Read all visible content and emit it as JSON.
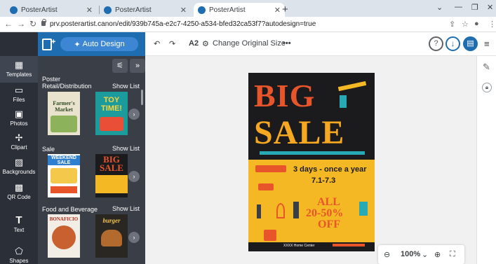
{
  "browser": {
    "tabs": [
      {
        "title": "PosterArtist",
        "active": false
      },
      {
        "title": "PosterArtist",
        "active": false
      },
      {
        "title": "PosterArtist",
        "active": true
      }
    ],
    "url": "prv.posterartist.canon/edit/939b745a-e2c7-4250-a534-bfed32ca53f7?autodesign=true"
  },
  "rail": {
    "items": [
      {
        "label": "Templates",
        "icon": "templates-icon"
      },
      {
        "label": "Files",
        "icon": "folder-icon"
      },
      {
        "label": "Photos",
        "icon": "photo-icon"
      },
      {
        "label": "Clipart",
        "icon": "clipart-icon"
      },
      {
        "label": "Backgrounds",
        "icon": "backgrounds-icon"
      },
      {
        "label": "QR Code",
        "icon": "qr-code-icon"
      },
      {
        "label": "Text",
        "icon": "text-icon"
      },
      {
        "label": "Shapes",
        "icon": "shapes-icon"
      }
    ]
  },
  "header": {
    "auto_design_label": "Auto Design"
  },
  "panel": {
    "categories": [
      {
        "title_line1": "Poster",
        "title_line2": "Retail/Distribution",
        "show_list": "Show List",
        "thumbs": [
          {
            "text": "Farmer's Market"
          },
          {
            "text": "TOY TIME!"
          }
        ]
      },
      {
        "title_line1": "Sale",
        "title_line2": "",
        "show_list": "Show List",
        "thumbs": [
          {
            "text": "WEEKEND SALE"
          },
          {
            "text": "BIG SALE"
          }
        ]
      },
      {
        "title_line1": "Food and Beverage",
        "title_line2": "",
        "show_list": "Show List",
        "thumbs": [
          {
            "text": "BONAFICIO"
          },
          {
            "text": "burger"
          }
        ]
      }
    ]
  },
  "editor_toolbar": {
    "size": "A2",
    "change_size_label": "Change Original Size",
    "more": "•••"
  },
  "poster": {
    "line1": "BIG",
    "line2": "SALE",
    "days": "3 days - once a year",
    "dates": "7.1-7.3",
    "all": "ALL",
    "percent": "20-50%",
    "off": "OFF",
    "footer": "XXXX Home Center"
  },
  "zoom": {
    "level": "100%"
  },
  "colors": {
    "accent": "#1e6db1",
    "rail_bg": "#2b2f38",
    "panel_bg": "#3a3e47",
    "poster_red": "#e8552b",
    "poster_orange": "#f6a820",
    "poster_yellow": "#f5b825"
  }
}
